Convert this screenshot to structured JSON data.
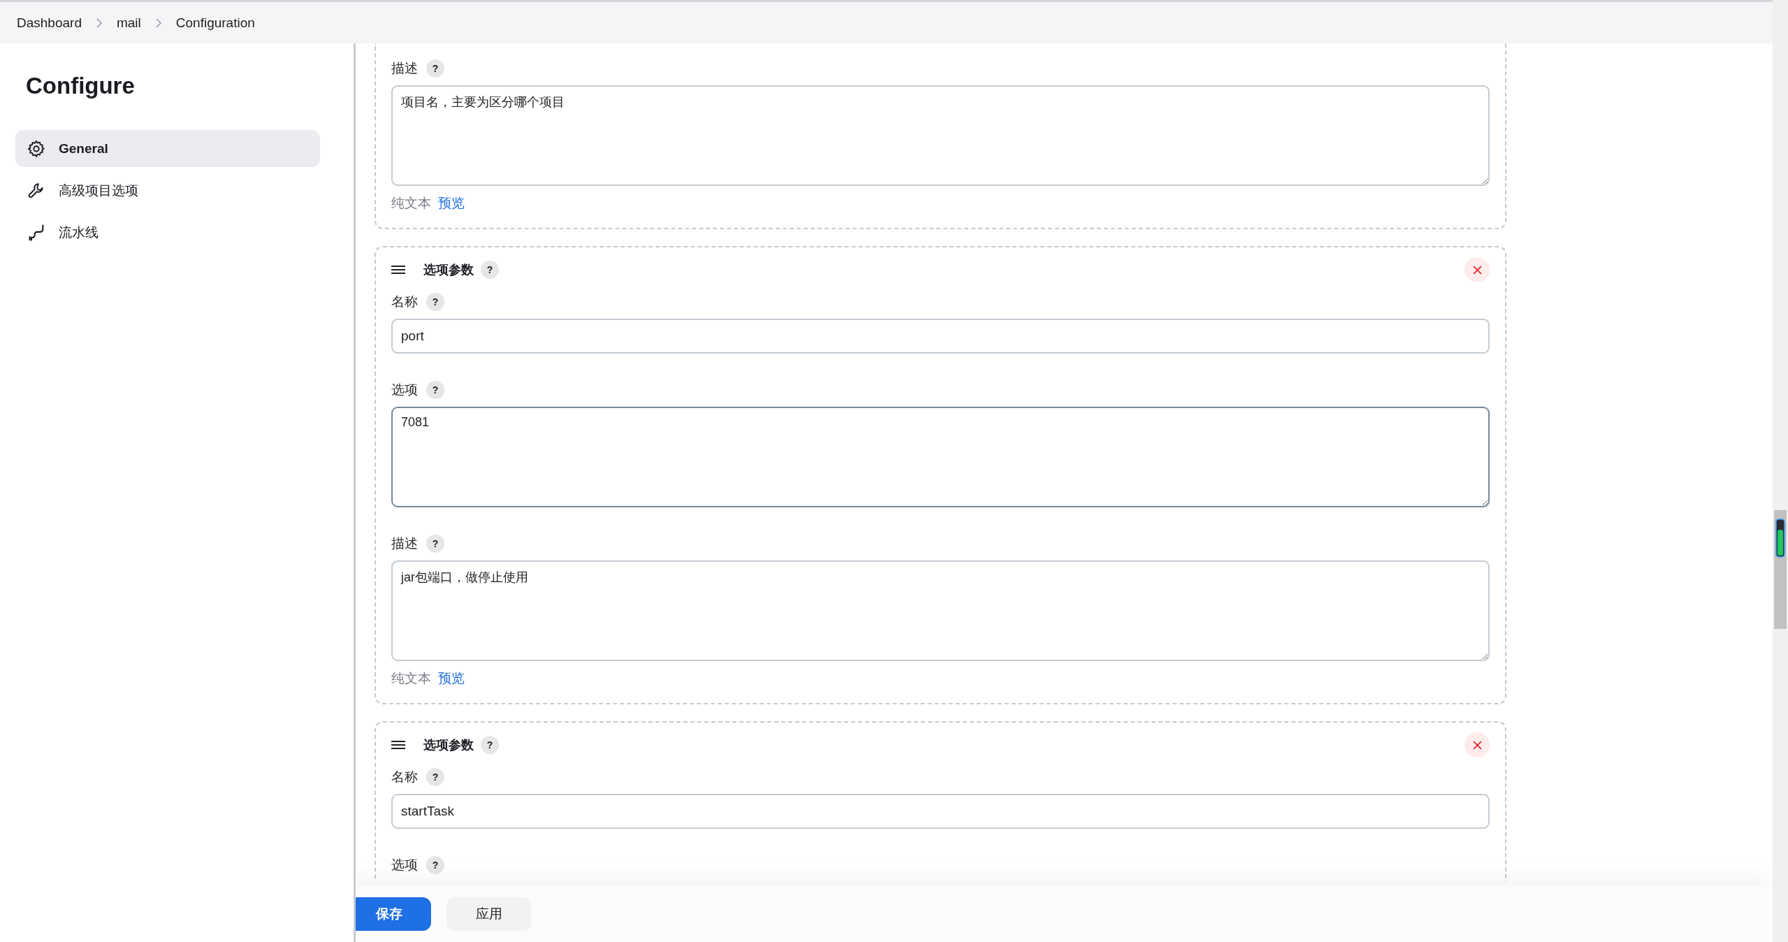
{
  "breadcrumb": [
    {
      "label": "Dashboard"
    },
    {
      "label": "mail"
    },
    {
      "label": "Configuration"
    }
  ],
  "sidebar": {
    "title": "Configure",
    "items": [
      {
        "label": "General",
        "kind": "general",
        "selected": true
      },
      {
        "label": "高级项目选项",
        "kind": "advanced",
        "selected": false
      },
      {
        "label": "流水线",
        "kind": "pipeline",
        "selected": false
      }
    ]
  },
  "sections": [
    {
      "fields": [
        {
          "kind": "textarea",
          "label": "描述",
          "help": "?",
          "value": "项目名，主要为区分哪个项目",
          "focused": false
        }
      ],
      "format": {
        "plain": "纯文本",
        "preview": "预览"
      }
    },
    {
      "header": {
        "title": "选项参数",
        "help": "?"
      },
      "removable": true,
      "fields": [
        {
          "kind": "input",
          "label": "名称",
          "help": "?",
          "value": "port",
          "focused": false
        },
        {
          "kind": "textarea",
          "label": "选项",
          "help": "?",
          "value": "7081",
          "focused": true
        },
        {
          "kind": "textarea",
          "label": "描述",
          "help": "?",
          "value": "jar包端口，做停止使用",
          "focused": false
        }
      ],
      "format": {
        "plain": "纯文本",
        "preview": "预览"
      }
    },
    {
      "header": {
        "title": "选项参数",
        "help": "?"
      },
      "removable": true,
      "fields": [
        {
          "kind": "input",
          "label": "名称",
          "help": "?",
          "value": "startTask",
          "focused": false
        },
        {
          "kind": "label",
          "label": "选项",
          "help": "?"
        }
      ]
    }
  ],
  "buttons": [
    {
      "label": "保存",
      "kind": "primary"
    },
    {
      "label": "应用",
      "kind": "secondary"
    }
  ]
}
